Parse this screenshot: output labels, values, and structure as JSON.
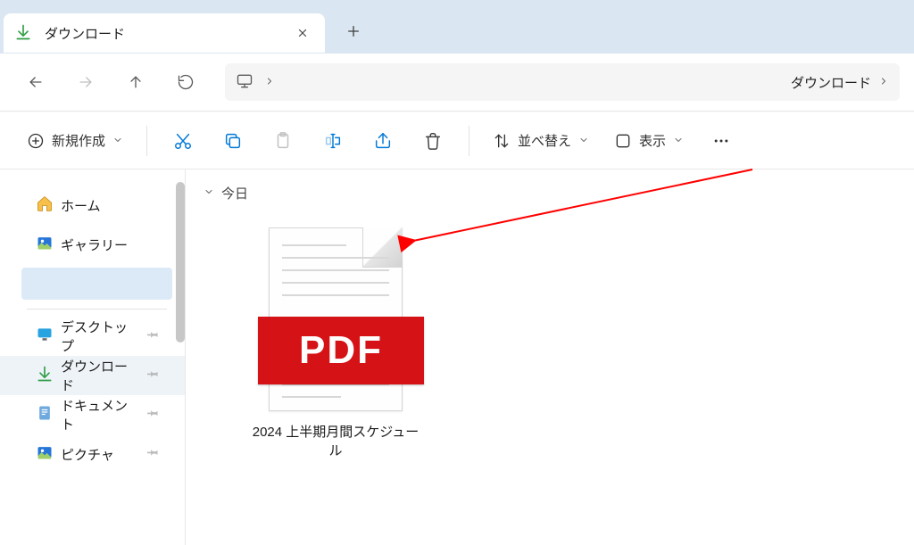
{
  "tab": {
    "title": "ダウンロード"
  },
  "address": {
    "current_label": "ダウンロード"
  },
  "toolbar": {
    "new_label": "新規作成",
    "sort_label": "並べ替え",
    "view_label": "表示"
  },
  "sidebar": {
    "home": "ホーム",
    "gallery": "ギャラリー",
    "desktop": "デスクトップ",
    "downloads": "ダウンロード",
    "documents": "ドキュメント",
    "pictures": "ピクチャ"
  },
  "content": {
    "group_today": "今日",
    "files": [
      {
        "name": "2024 上半期月間スケジュール",
        "badge": "PDF"
      }
    ]
  }
}
